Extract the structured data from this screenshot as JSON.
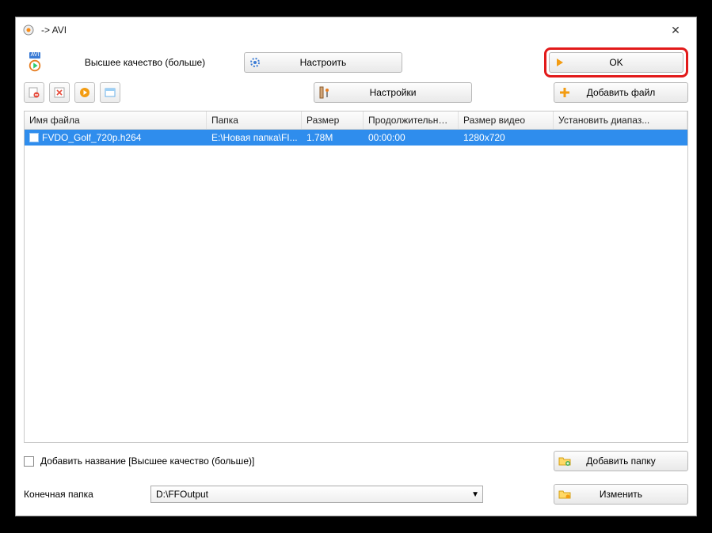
{
  "titlebar": {
    "title": "-> AVI"
  },
  "top": {
    "avi_badge": "AVI",
    "quality_label": "Высшее качество (больше)",
    "configure_label": "Настроить",
    "ok_label": "OK"
  },
  "toolbar": {
    "settings_label": "Настройки",
    "add_file_label": "Добавить файл"
  },
  "table": {
    "headers": {
      "name": "Имя файла",
      "folder": "Папка",
      "size": "Размер",
      "duration": "Продолжительность",
      "videosize": "Размер видео",
      "range": "Установить диапаз..."
    },
    "rows": [
      {
        "name": "FVDO_Golf_720p.h264",
        "folder": "E:\\Новая папка\\FI...",
        "size": "1.78M",
        "duration": "00:00:00",
        "videosize": "1280x720",
        "range": ""
      }
    ]
  },
  "footer": {
    "add_title_label": "Добавить название [Высшее качество (больше)]",
    "add_folder_label": "Добавить папку",
    "dest_label": "Конечная папка",
    "dest_value": "D:\\FFOutput",
    "change_label": "Изменить"
  }
}
